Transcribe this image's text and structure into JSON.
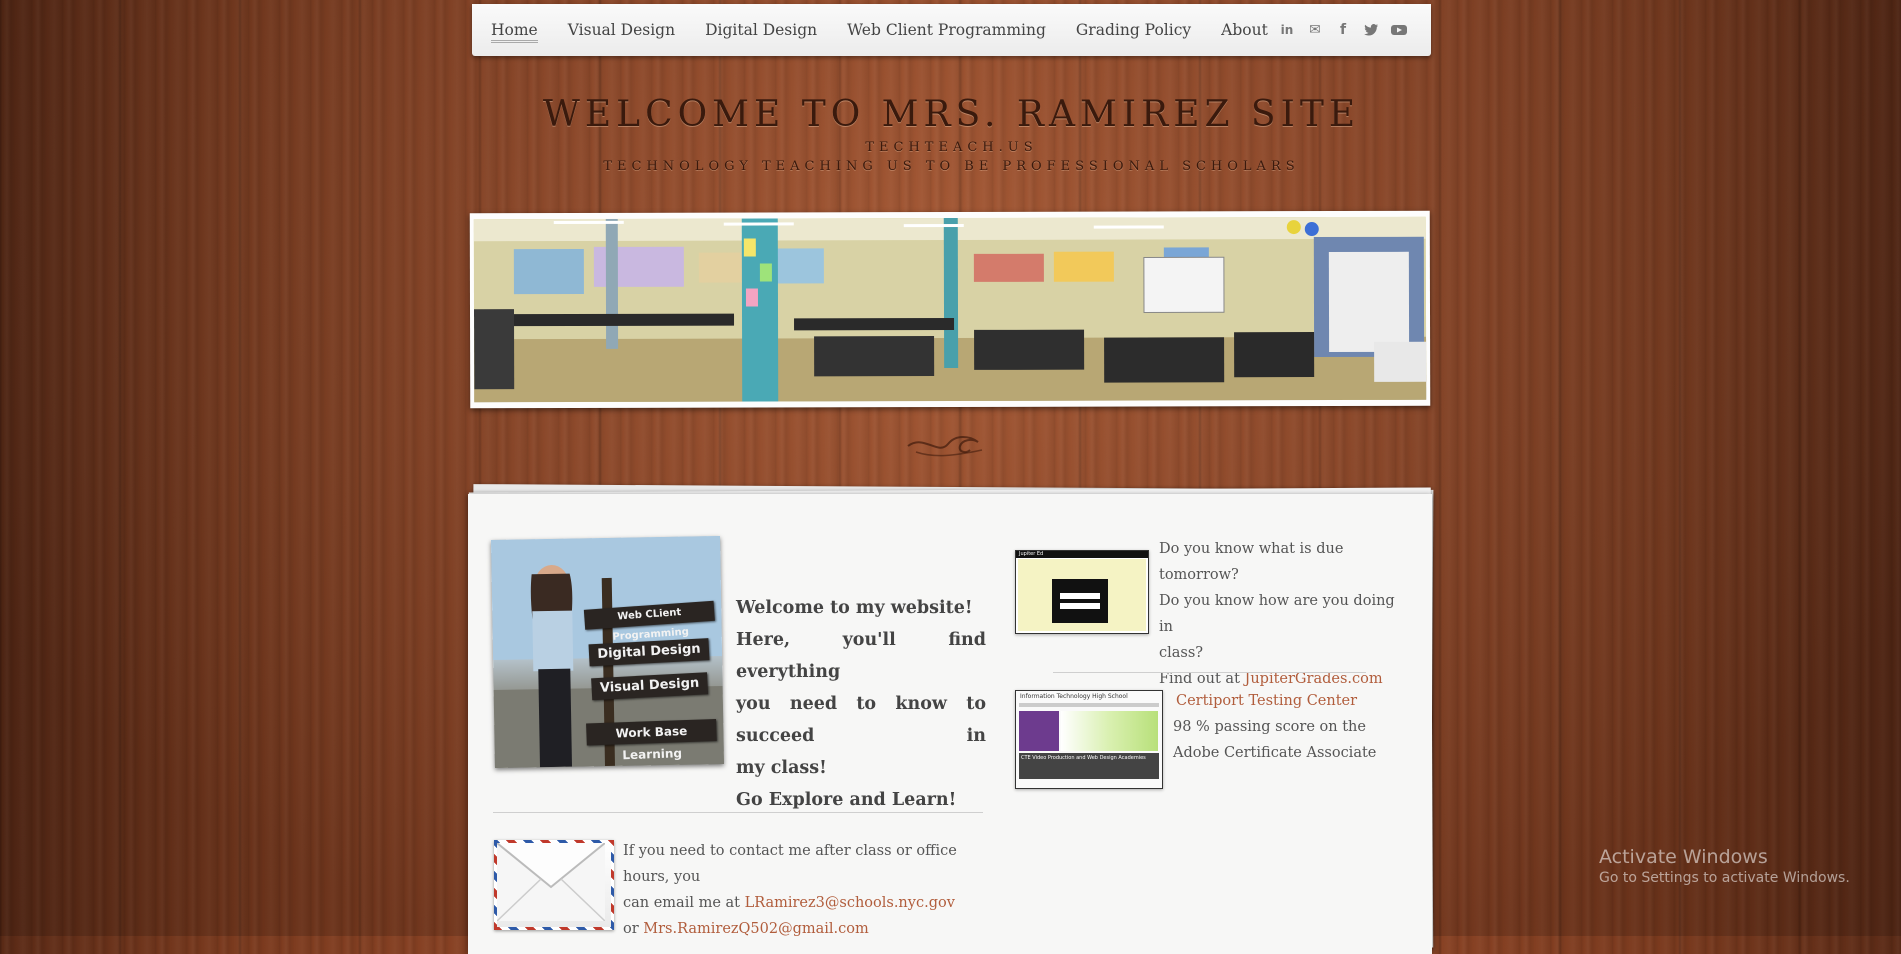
{
  "nav": {
    "items": [
      {
        "label": "Home",
        "active": true
      },
      {
        "label": "Visual Design"
      },
      {
        "label": "Digital Design"
      },
      {
        "label": "Web Client Programming"
      },
      {
        "label": "Grading Policy"
      },
      {
        "label": "About"
      }
    ],
    "social": [
      {
        "icon": "linkedin-icon",
        "glyph": "in"
      },
      {
        "icon": "email-icon",
        "glyph": "✉"
      },
      {
        "icon": "facebook-icon",
        "glyph": "f"
      },
      {
        "icon": "twitter-icon",
        "glyph": "🐦"
      },
      {
        "icon": "youtube-icon",
        "glyph": "▶"
      }
    ]
  },
  "header": {
    "title": "WELCOME TO MRS. RAMIREZ SITE",
    "subtitle": "TECHTEACH.US",
    "tagline": "TECHNOLOGY TEACHING US TO BE PROFESSIONAL SCHOLARS"
  },
  "photo": {
    "signs": [
      "Web CLient Programming",
      "Digital Design",
      "Visual Design",
      "Work Base Learning"
    ]
  },
  "welcome": {
    "line1": "Welcome to my website!",
    "line2": "Here, you'll find everything",
    "line3": "you need to know to succeed in",
    "line4": "my class!",
    "line5": "Go Explore and Learn!"
  },
  "jupiter": {
    "q1": "Do you know what is due tomorrow?",
    "q2a": "Do you know how are you doing in",
    "q2b": "class?",
    "find_prefix": "Find out at ",
    "link": "JupiterGrades.com",
    "thumb_header": "Jupiter Ed"
  },
  "certiport": {
    "link": "Certiport Testing Center",
    "line1": "98 % passing score  on the",
    "line2": "Adobe Certificate Associate",
    "thumb_title": "Information Technology High School",
    "thumb_caption": "CTE Video Production and Web Design Academies"
  },
  "contact": {
    "line1": "If you need to contact me after class or office hours, you",
    "line2_prefix": "can email me at ",
    "email1": "LRamirez3@schools.nyc.gov",
    "line3_prefix": "or ",
    "email2": "Mrs.RamirezQ502@gmail.com"
  },
  "windows": {
    "title": "Activate Windows",
    "subtitle": "Go to Settings to activate Windows."
  },
  "colors": {
    "link": "#b15d3c",
    "nav_bg": "#f3f3f3",
    "wood": "#8e4526"
  }
}
